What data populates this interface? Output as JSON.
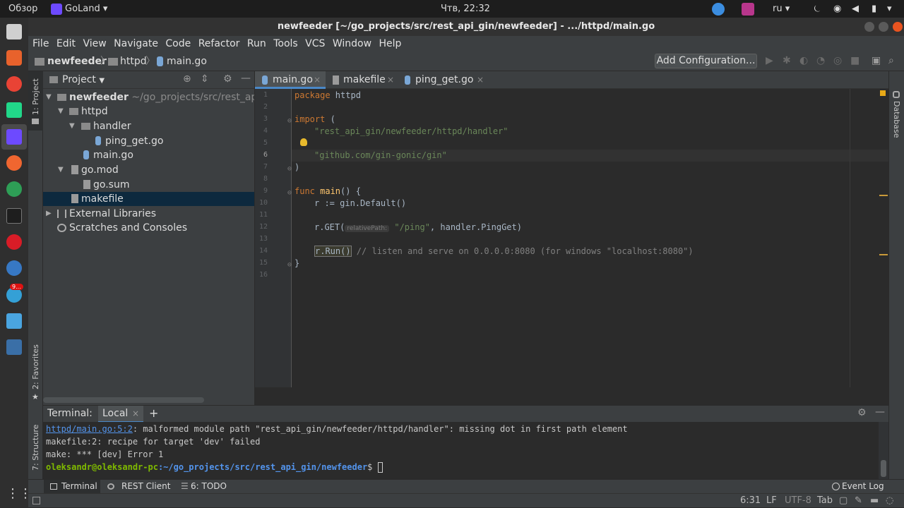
{
  "topbar": {
    "activities": "Обзор",
    "app_name": "GoLand",
    "app_chevron": "▾",
    "clock": "Чтв, 22:32",
    "keyboard_layout": "ru",
    "chevron": "▾",
    "moon": "⏾",
    "wifi": "◉",
    "volume": "◀",
    "battery": "▮"
  },
  "window": {
    "title": "newfeeder [~/go_projects/src/rest_api_gin/newfeeder] - .../httpd/main.go"
  },
  "menu": [
    "File",
    "Edit",
    "View",
    "Navigate",
    "Code",
    "Refactor",
    "Run",
    "Tools",
    "VCS",
    "Window",
    "Help"
  ],
  "breadcrumb": {
    "project": "newfeeder",
    "folder": "httpd",
    "file": "main.go"
  },
  "toolbar": {
    "add_configuration": "Add Configuration..."
  },
  "left_strip": {
    "project_tab": "1: Project",
    "favorites_tab": "2: Favorites",
    "structure_tab": "7: Structure"
  },
  "right_strip": {
    "database_tab": "Database"
  },
  "project_panel": {
    "title": "Project",
    "tree": [
      {
        "label": "newfeeder",
        "hint": " ~/go_projects/src/rest_api_g"
      },
      {
        "label": "httpd"
      },
      {
        "label": "handler"
      },
      {
        "label": "ping_get.go"
      },
      {
        "label": "main.go"
      },
      {
        "label": "go.mod"
      },
      {
        "label": "go.sum"
      },
      {
        "label": "makefile"
      },
      {
        "label": "External Libraries"
      },
      {
        "label": "Scratches and Consoles"
      }
    ]
  },
  "editor": {
    "tabs": [
      "main.go",
      "makefile",
      "ping_get.go"
    ],
    "line_numbers": [
      "1",
      "2",
      "3",
      "4",
      "5",
      "6",
      "7",
      "8",
      "9",
      "10",
      "11",
      "12",
      "13",
      "14",
      "15",
      "16"
    ],
    "code": {
      "l1_kw": "package",
      "l1_rest": " httpd",
      "l3_kw": "import",
      "l3_rest": " (",
      "l4": "\"rest_api_gin/newfeeder/httpd/handler\"",
      "l6": "\"github.com/gin-gonic/gin\"",
      "l7": ")",
      "l9_kw": "func",
      "l9_fn": " main",
      "l9_rest": "() {",
      "l10": "r := gin.Default()",
      "l12_a": "r.GET(",
      "l12_hint": "relativePath:",
      "l12_str": " \"/ping\"",
      "l12_rest": ", handler.PingGet)",
      "l14_code": "r.Run()",
      "l14_cm": " // listen and serve on 0.0.0.0:8080 (for windows \"localhost:8080\")",
      "l15": "}"
    }
  },
  "terminal": {
    "label": "Terminal:",
    "tab": "Local",
    "close": "×",
    "add": "+",
    "lines": {
      "err_link": "httpd/main.go:5:2",
      "err_text": ": malformed module path \"rest_api_gin/newfeeder/httpd/handler\": missing dot in first path element",
      "line2": "makefile:2: recipe for target 'dev' failed",
      "line3": "make: *** [dev] Error 1",
      "prompt_user": "oleksandr@oleksandr-pc",
      "prompt_path": ":~/go_projects/src/rest_api_gin/newfeeder",
      "prompt_symbol": "$"
    }
  },
  "bottom_tools": {
    "terminal": "Terminal",
    "rest_client": "REST Client",
    "todo": "6: TODO",
    "event_log": "Event Log"
  },
  "status": {
    "position": "6:31",
    "line_sep": "LF",
    "encoding": "UTF-8",
    "indent": "Tab"
  },
  "notification_badge": "9...",
  "colors": {
    "accent": "#4a88c7",
    "keyword": "#cc7832",
    "string": "#6a8759",
    "function": "#ffc66d",
    "prompt_user": "#7fba00",
    "prompt_path": "#5394ec"
  }
}
